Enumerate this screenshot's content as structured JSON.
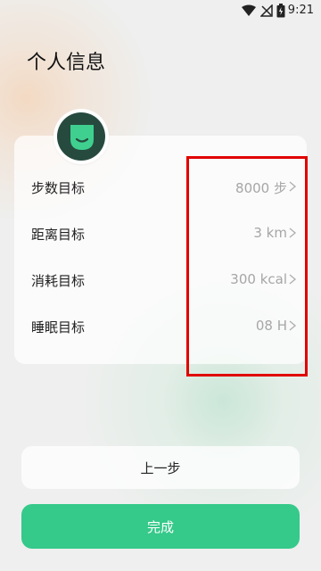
{
  "status_bar": {
    "time": "9:21"
  },
  "header": {
    "title": "个人信息"
  },
  "goals": [
    {
      "label": "步数目标",
      "value": "8000 步"
    },
    {
      "label": "距离目标",
      "value": "3 km"
    },
    {
      "label": "消耗目标",
      "value": "300 kcal"
    },
    {
      "label": "睡眠目标",
      "value": "08 H"
    }
  ],
  "buttons": {
    "prev": "上一步",
    "done": "完成"
  },
  "colors": {
    "accent": "#35c98a",
    "highlight": "#e00000",
    "avatar_bg": "#274a3f"
  }
}
